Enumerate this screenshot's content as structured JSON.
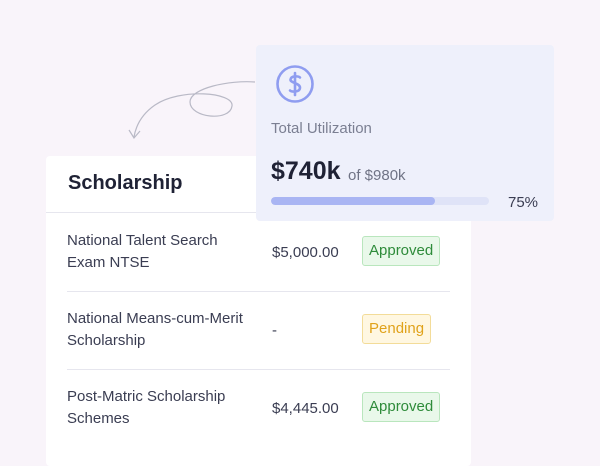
{
  "scholarship_card": {
    "title": "Scholarship",
    "rows": [
      {
        "name": "National Talent Search Exam NTSE",
        "amount": "$5,000.00",
        "status": "Approved",
        "status_type": "approved"
      },
      {
        "name": "National Means-cum-Merit Scholarship",
        "amount": "-",
        "status": "Pending",
        "status_type": "pending"
      },
      {
        "name": "Post-Matric Scholarship Schemes",
        "amount": "$4,445.00",
        "status": "Approved",
        "status_type": "approved"
      }
    ]
  },
  "utilization": {
    "icon": "dollar-circle-icon",
    "label": "Total Utilization",
    "amount": "$740k",
    "of_total": "of $980k",
    "percent_text": "75%",
    "progress": 0.75
  },
  "colors": {
    "accent": "#8f9df0",
    "approved": "#2e8b3a",
    "pending": "#e0a21a"
  }
}
